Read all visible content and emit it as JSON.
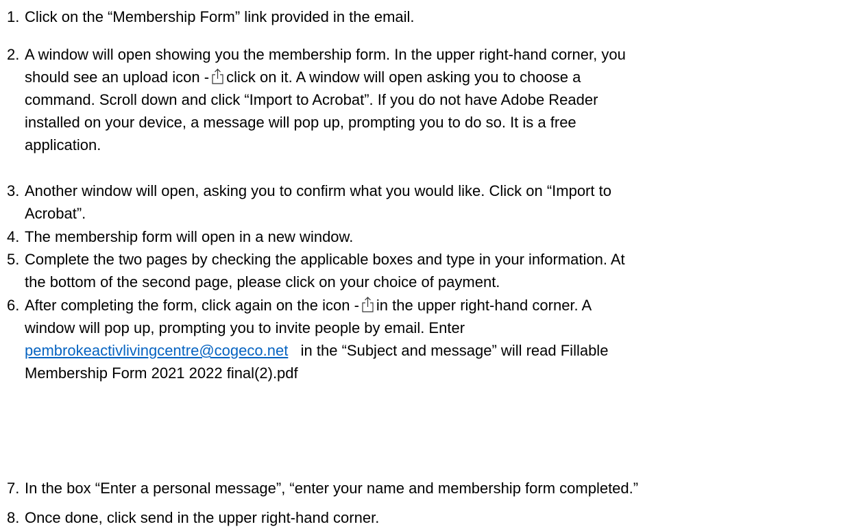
{
  "steps": [
    {
      "n": "1.",
      "lines": [
        "Click on the “Membership Form” link provided in the email."
      ]
    },
    {
      "n": "2.",
      "l1": "A window will open showing you the membership form.  In the upper right-hand corner, you",
      "l2a": "should see an upload icon -",
      "l2b": "click on it.  A window will open asking you to choose a",
      "l3": "command.  Scroll down and click “Import to Acrobat”.  If you do not have Adobe Reader",
      "l4": "installed on your device, a message will pop up, prompting you to do so.  It is a free",
      "l5": "application."
    },
    {
      "n": "3.",
      "l1": "Another window will open, asking you to confirm what you would like.  Click on “Import to",
      "l2": "Acrobat”."
    },
    {
      "n": "4.",
      "l1": "The membership form will open in a new window."
    },
    {
      "n": "5.",
      "l1": "Complete the two pages by checking the applicable boxes and type in your information.  At",
      "l2": "the bottom of the second page, please click on your choice of payment."
    },
    {
      "n": "6.",
      "l1a": "After completing the form, click again on the icon -",
      "l1b": "in the upper right-hand corner.  A",
      "l2": "window will pop up, prompting you to invite people by email.  Enter",
      "email": "pembrokeactivlivingcentre@cogeco.net",
      "l3b": "in the “Subject and message” will read Fillable",
      "l4": "Membership Form 2021 2022 final(2).pdf"
    },
    {
      "n": "7.",
      "l1": "In the box “Enter a personal message”, “enter your name and membership form completed.”"
    },
    {
      "n": "8.",
      "l1": "Once done, click send in the upper right-hand corner."
    }
  ],
  "icons": {
    "upload": "share-upload-icon"
  },
  "colors": {
    "link": "#0563c1",
    "text": "#000000"
  }
}
